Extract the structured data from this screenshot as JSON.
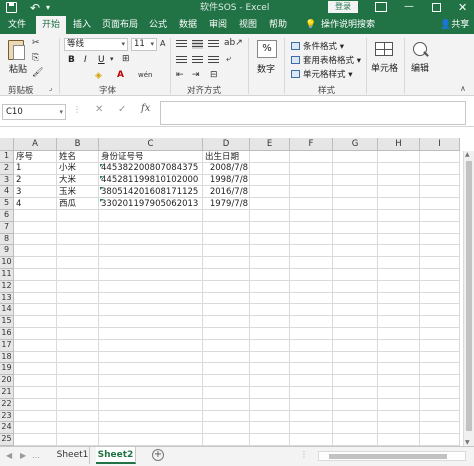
{
  "titlebar": {
    "title": "软件SOS  -  Excel",
    "login": "登录"
  },
  "tabs": [
    "文件",
    "开始",
    "插入",
    "页面布局",
    "公式",
    "数据",
    "审阅",
    "视图",
    "帮助"
  ],
  "active_tab": "开始",
  "tell_me": "操作说明搜索",
  "share": "共享",
  "ribbon": {
    "clipboard": {
      "paste": "粘贴",
      "group": "剪贴板"
    },
    "font": {
      "name": "等线",
      "size": "11",
      "group": "字体"
    },
    "alignment": {
      "group": "对齐方式"
    },
    "number": {
      "label": "数字",
      "pct": "%"
    },
    "styles": {
      "conditional": "条件格式 ▾",
      "table": "套用表格格式 ▾",
      "cell_styles": "单元格样式 ▾",
      "group": "样式"
    },
    "cells": {
      "label": "单元格"
    },
    "editing": {
      "label": "编辑"
    }
  },
  "formula_bar": {
    "name_box": "C10",
    "fx": "fx",
    "content": ""
  },
  "grid": {
    "columns": [
      "A",
      "B",
      "C",
      "D",
      "E",
      "F",
      "G",
      "H",
      "I"
    ],
    "rows": [
      "1",
      "2",
      "3",
      "4",
      "5",
      "6",
      "7",
      "8",
      "9",
      "10",
      "11",
      "12",
      "13",
      "14",
      "15",
      "16",
      "17",
      "18",
      "19",
      "20",
      "21",
      "22",
      "23",
      "24",
      "25"
    ],
    "cells": {
      "A1": "序号",
      "B1": "姓名",
      "C1": "身份证号号",
      "D1": "出生日期",
      "A2": "1",
      "B2": "小米",
      "C2": "445382200807084375",
      "D2": "2008/7/8",
      "A3": "2",
      "B3": "大米",
      "C3": "445281199810102000",
      "D3": "1998/7/8",
      "A4": "3",
      "B4": "玉米",
      "C4": "380514201608171125",
      "D4": "2016/7/8",
      "A5": "4",
      "B5": "西瓜",
      "C5": "330201197905062013",
      "D5": "1979/7/8"
    }
  },
  "sheets": [
    "Sheet1",
    "Sheet2"
  ],
  "active_sheet": "Sheet2",
  "colors": {
    "brand": "#217346",
    "error_marker": "#1e7b45"
  }
}
